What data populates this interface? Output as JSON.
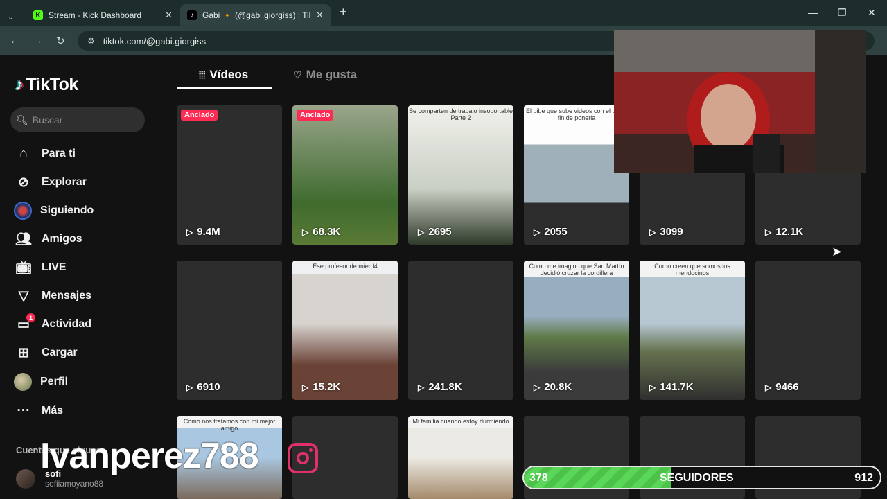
{
  "browser": {
    "tabs": [
      {
        "title": "Stream - Kick Dashboard",
        "icon": "kick-icon"
      },
      {
        "title": "Gabi 🔸 (@gabi.giorgiss) | TikTok",
        "icon": "tiktok-icon"
      }
    ],
    "new_tab": "+",
    "url": "tiktok.com/@gabi.giorgiss"
  },
  "sidebar": {
    "logo": "TikTok",
    "search_placeholder": "Buscar",
    "items": [
      {
        "label": "Para ti",
        "icon": "home-icon"
      },
      {
        "label": "Explorar",
        "icon": "compass-icon"
      },
      {
        "label": "Siguiendo",
        "icon": "following-avatar"
      },
      {
        "label": "Amigos",
        "icon": "friends-icon"
      },
      {
        "label": "LIVE",
        "icon": "live-icon"
      },
      {
        "label": "Mensajes",
        "icon": "messages-icon"
      },
      {
        "label": "Actividad",
        "icon": "activity-icon",
        "badge": "1"
      },
      {
        "label": "Cargar",
        "icon": "upload-icon"
      },
      {
        "label": "Perfil",
        "icon": "profile-avatar"
      },
      {
        "label": "Más",
        "icon": "more-icon"
      }
    ],
    "following_title": "Cuentas que sigues",
    "following": [
      {
        "name": "sofi",
        "username": "sofiiamoyano88"
      }
    ]
  },
  "content_tabs": [
    {
      "label": "Vídeos",
      "icon": "grid-icon",
      "active": true
    },
    {
      "label": "Me gusta",
      "icon": "heart-icon",
      "active": false
    }
  ],
  "videos": [
    {
      "views": "9.4M",
      "pinned": "Anclado",
      "caption": ""
    },
    {
      "views": "68.3K",
      "pinned": "Anclado",
      "caption": ""
    },
    {
      "views": "2695",
      "pinned": "",
      "caption": "Se comparten de trabajo insoportable Parte 2"
    },
    {
      "views": "2055",
      "pinned": "",
      "caption": "El pibe que sube videos con el unico fin de ponerla"
    },
    {
      "views": "3099",
      "pinned": "",
      "caption": ""
    },
    {
      "views": "12.1K",
      "pinned": "",
      "caption": ""
    },
    {
      "views": "6910",
      "pinned": "",
      "caption": ""
    },
    {
      "views": "15.2K",
      "pinned": "",
      "caption": "Ese profesor de mierd4"
    },
    {
      "views": "241.8K",
      "pinned": "",
      "caption": ""
    },
    {
      "views": "20.8K",
      "pinned": "",
      "caption": "Como me imagino que San Martín decidió cruzar la cordillera"
    },
    {
      "views": "141.7K",
      "pinned": "",
      "caption": "Como creen que somos los mendocinos"
    },
    {
      "views": "9466",
      "pinned": "",
      "caption": ""
    },
    {
      "views": "",
      "pinned": "",
      "caption": "Como nos tratamos con mi mejor amigo"
    },
    {
      "views": "",
      "pinned": "",
      "caption": ""
    },
    {
      "views": "",
      "pinned": "",
      "caption": "Mi familia cuando estoy durmiendo"
    },
    {
      "views": "",
      "pinned": "",
      "caption": ""
    },
    {
      "views": "",
      "pinned": "",
      "caption": ""
    },
    {
      "views": "",
      "pinned": "",
      "caption": ""
    }
  ],
  "stream_overlay": {
    "streamer_name": "Ivanperez788",
    "goal": {
      "current": "378",
      "label": "SEGUIDORES",
      "target": "912",
      "progress": 0.415
    }
  },
  "colors": {
    "accent": "#fe2c55",
    "goal_green": "#4cc24a",
    "browser_chrome": "#1c2d2c"
  }
}
